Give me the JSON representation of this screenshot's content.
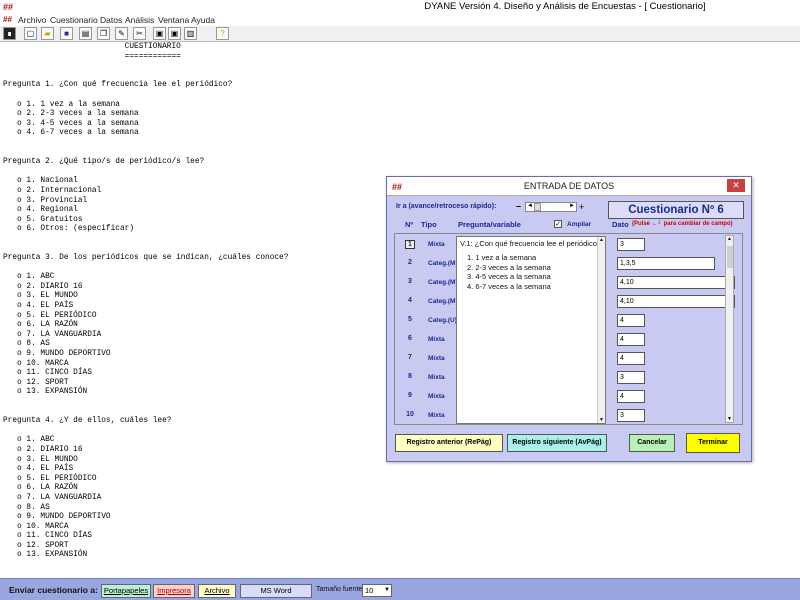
{
  "window": {
    "title": "DYANE Versión 4.  Diseño y  Análisis de Encuestas - [  Cuestionario]",
    "logo": "##"
  },
  "menu": [
    "Archivo",
    "Cuestionario",
    "Datos",
    "Análisis",
    "Ventana",
    "Ayuda"
  ],
  "toolbar": {
    "icons": [
      "app-icon",
      "new-icon",
      "open-icon",
      "save-icon",
      "print-icon",
      "copy-icon",
      "edit-icon",
      "cut-icon",
      "window-icon",
      "window-icon",
      "tile-icon",
      "help-icon"
    ]
  },
  "document": {
    "lines": [
      "                          CUESTIONARIO",
      "                          ============",
      "",
      "",
      "Pregunta 1. ¿Con qué frecuencia lee el periódico?",
      "",
      "   o 1. 1 vez a la semana",
      "   o 2. 2-3 veces a la semana",
      "   o 3. 4-5 veces a la semana",
      "   o 4. 6-7 veces a la semana",
      "",
      "",
      "Pregunta 2. ¿Qué tipo/s de periódico/s lee?",
      "",
      "   o 1. Nacional",
      "   o 2. Internacional",
      "   o 3. Provincial",
      "   o 4. Regional",
      "   o 5. Gratuitos",
      "   o 6. Otros: (especificar)",
      "",
      "",
      "Pregunta 3. De los periódicos que se indican, ¿cuáles conoce?",
      "",
      "   o 1. ABC",
      "   o 2. DIARIO 16",
      "   o 3. EL MUNDO",
      "   o 4. EL PAÍS",
      "   o 5. EL PERIÓDICO",
      "   o 6. LA RAZÓN",
      "   o 7. LA VANGUARDIA",
      "   o 8. AS",
      "   o 9. MUNDO DEPORTIVO",
      "   o 10. MARCA",
      "   o 11. CINCO DÍAS",
      "   o 12. SPORT",
      "   o 13. EXPANSIÓN",
      "",
      "",
      "Pregunta 4. ¿Y de ellos, cuáles lee?",
      "",
      "   o 1. ABC",
      "   o 2. DIARIO 16",
      "   o 3. EL MUNDO",
      "   o 4. EL PAÍS",
      "   o 5. EL PERIÓDICO",
      "   o 6. LA RAZÓN",
      "   o 7. LA VANGUARDIA",
      "   o 8. AS",
      "   o 9. MUNDO DEPORTIVO",
      "   o 10. MARCA",
      "   o 11. CINCO DÍAS",
      "   o 12. SPORT",
      "   o 13. EXPANSIÓN"
    ]
  },
  "dialog": {
    "title": "ENTRADA DE DATOS",
    "close": "✕",
    "goto_label": "Ir a (avance/retroceso rápido):",
    "goto_minus": "–",
    "goto_plus": "+",
    "questionnaire_title": "Cuestionario Nº 6",
    "headers": {
      "num": "Nº",
      "type": "Tipo",
      "question": "Pregunta/variable",
      "ampliar": "Ampliar",
      "ampliar_checked": "✓",
      "dato": "Dato",
      "dato_note": "(Pulse ←┘ para cambiar de campo)"
    },
    "question": {
      "text": "V.1: ¿Con qué frecuencia lee el periódico?",
      "options": [
        "1. 1 vez a la semana",
        "2. 2-3 veces a la semana",
        "3. 4-5 veces a la semana",
        "4. 6-7 veces a la semana"
      ]
    },
    "rows": [
      {
        "num": "1",
        "type": "Mixta",
        "value": "3"
      },
      {
        "num": "2",
        "type": "Categ.(M)",
        "value": "1,3,5"
      },
      {
        "num": "3",
        "type": "Categ.(M)",
        "value": "4,10"
      },
      {
        "num": "4",
        "type": "Categ.(M)",
        "value": "4,10"
      },
      {
        "num": "5",
        "type": "Categ.(U)",
        "value": "4"
      },
      {
        "num": "6",
        "type": "Mixta",
        "value": "4"
      },
      {
        "num": "7",
        "type": "Mixta",
        "value": "4"
      },
      {
        "num": "8",
        "type": "Mixta",
        "value": "3"
      },
      {
        "num": "9",
        "type": "Mixta",
        "value": "4"
      },
      {
        "num": "10",
        "type": "Mixta",
        "value": "3"
      }
    ],
    "buttons": {
      "prev": "Registro anterior (RePág)",
      "next": "Registro siguiente (AvPág)",
      "cancel": "Cancelar",
      "finish": "Terminar"
    }
  },
  "bottombar": {
    "label": "Enviar cuestionario a:",
    "buttons": [
      "Portapapeles",
      "Impresora",
      "Archivo",
      "MS Word"
    ],
    "font_size_label": "Tamaño fuente:",
    "font_size_value": "10"
  },
  "colors": {
    "dialog_bg": "#c8caf2",
    "bottombar_bg": "#9aa6e0",
    "label_blue": "#1a2a90",
    "logo_red": "#b01010",
    "btn_prev_bg": "#ffffc0",
    "btn_next_bg": "#a8f0e8",
    "btn_cancel_bg": "#b8f0b8",
    "btn_finish_bg": "#ffff00",
    "bb_portapapeles_bg": "#b8f0d8",
    "bb_impresora_bg": "#ffd0d0",
    "bb_archivo_bg": "#ffffd0",
    "bb_msword_bg": "#d8dcf8"
  }
}
